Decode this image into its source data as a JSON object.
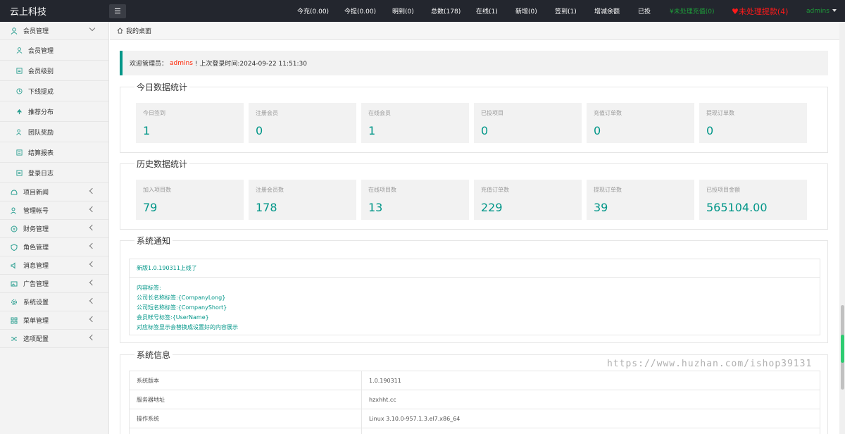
{
  "header": {
    "logo": "云上科技",
    "nav": [
      {
        "label": "今充(0.00)"
      },
      {
        "label": "今提(0.00)"
      },
      {
        "label": "明到(0)"
      },
      {
        "label": "总数(178)"
      },
      {
        "label": "在线(1)"
      },
      {
        "label": "新增(0)"
      },
      {
        "label": "签到(1)"
      },
      {
        "label": "增减余额"
      },
      {
        "label": "已投"
      }
    ],
    "pending_recharge": "未处理充值(0)",
    "pending_withdraw": "未处理提款(4)",
    "user": "admins"
  },
  "sidebar": {
    "member_group": "会员管理",
    "member_items": [
      {
        "label": "会员管理",
        "icon": "user-icon"
      },
      {
        "label": "会员级别",
        "icon": "list-icon"
      },
      {
        "label": "下线提成",
        "icon": "clock-icon"
      },
      {
        "label": "推荐分布",
        "icon": "tree-icon"
      },
      {
        "label": "团队奖励",
        "icon": "users-icon"
      },
      {
        "label": "结算报表",
        "icon": "list-icon"
      },
      {
        "label": "登录日志",
        "icon": "list-icon"
      }
    ],
    "groups": [
      {
        "label": "项目新闻",
        "icon": "news-icon"
      },
      {
        "label": "管理帐号",
        "icon": "users-icon"
      },
      {
        "label": "财务管理",
        "icon": "yen-icon"
      },
      {
        "label": "角色管理",
        "icon": "shield-icon"
      },
      {
        "label": "消息管理",
        "icon": "sound-icon"
      },
      {
        "label": "广告管理",
        "icon": "image-icon"
      },
      {
        "label": "系统设置",
        "icon": "gear-icon"
      },
      {
        "label": "菜单管理",
        "icon": "grid-icon"
      },
      {
        "label": "选项配置",
        "icon": "shuffle-icon"
      }
    ]
  },
  "breadcrumb": "我的桌面",
  "welcome": {
    "prefix": "欢迎管理员：",
    "name": "admins",
    "suffix": "! 上次登录时间:2024-09-22 11:51:30"
  },
  "today": {
    "title": "今日数据统计",
    "items": [
      {
        "label": "今日签到",
        "value": "1"
      },
      {
        "label": "注册会员",
        "value": "0"
      },
      {
        "label": "在线会员",
        "value": "1"
      },
      {
        "label": "已投项目",
        "value": "0"
      },
      {
        "label": "充值订单数",
        "value": "0"
      },
      {
        "label": "提现订单数",
        "value": "0"
      }
    ]
  },
  "history": {
    "title": "历史数据统计",
    "items": [
      {
        "label": "加入项目数",
        "value": "79"
      },
      {
        "label": "注册会员数",
        "value": "178"
      },
      {
        "label": "在线项目数",
        "value": "13"
      },
      {
        "label": "充值订单数",
        "value": "229"
      },
      {
        "label": "提现订单数",
        "value": "39"
      },
      {
        "label": "已投项目金额",
        "value": "565104.00"
      }
    ]
  },
  "notice": {
    "title": "系统通知",
    "headline": "新版1.0.190311上线了",
    "lines": [
      "内容标签:",
      "公司长名称标签:{CompanyLong}",
      "公司短名称标签:{CompanyShort}",
      "会员帐号标签:{UserName}",
      "对应标签显示会替换成设置好的内容展示"
    ]
  },
  "sysinfo": {
    "title": "系统信息",
    "rows": [
      {
        "k": "系统版本",
        "v": "1.0.190311"
      },
      {
        "k": "服务器地址",
        "v": "hzxhht.cc"
      },
      {
        "k": "操作系统",
        "v": "Linux 3.10.0-957.1.3.el7.x86_64"
      }
    ]
  },
  "watermark": "https://www.huzhan.com/ishop39131"
}
